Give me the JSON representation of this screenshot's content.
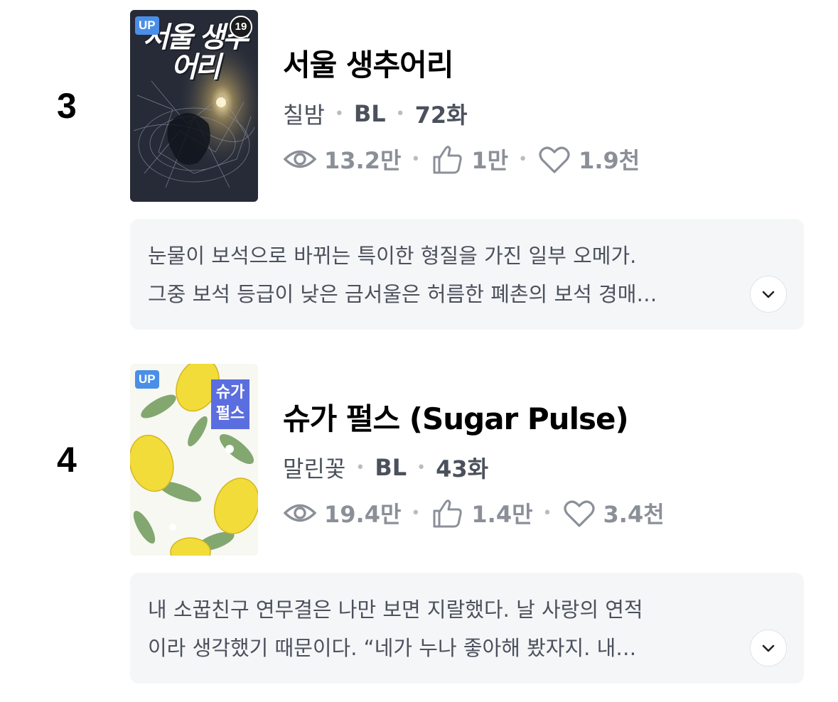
{
  "entries": [
    {
      "rank": "3",
      "badge": "UP",
      "age_rating": "19",
      "cover_title": "서울 생추어리",
      "title": "서울 생추어리",
      "author": "칠밤",
      "genre": "BL",
      "episodes": "72화",
      "views": "13.2만",
      "likes": "1만",
      "favorites": "1.9천",
      "synopsis_line1": "눈물이 보석으로 바뀌는 특이한 형질을 가진 일부 오메가.",
      "synopsis_line2": "그중 보석 등급이 낮은 금서울은 허름한 폐촌의 보석 경매…"
    },
    {
      "rank": "4",
      "badge": "UP",
      "cover_title": "슈가 펄스",
      "title": "슈가 펄스 (Sugar Pulse)",
      "author": "말린꽃",
      "genre": "BL",
      "episodes": "43화",
      "views": "19.4만",
      "likes": "1.4만",
      "favorites": "3.4천",
      "synopsis_line1": "내 소꿉친구 연무결은 나만 보면 지랄했다. 날 사랑의 연적",
      "synopsis_line2": "이라 생각했기 때문이다.    “네가 누나 좋아해 봤자지. 내…"
    }
  ],
  "icons": {
    "views": "eye-icon",
    "likes": "thumbs-up-icon",
    "favorites": "heart-icon",
    "expand": "chevron-down-icon"
  },
  "colors": {
    "badge_up": "#4a8fe7",
    "stat_gray": "#8b8f98",
    "synopsis_bg": "#f5f6f8"
  }
}
